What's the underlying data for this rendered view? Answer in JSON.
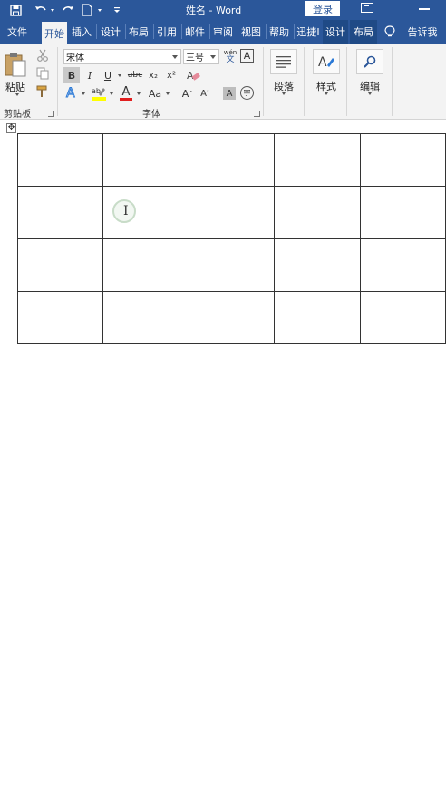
{
  "window": {
    "title": "姓名 - Word",
    "login_label": "登录"
  },
  "tabs": [
    {
      "label": "文件"
    },
    {
      "label": "开始"
    },
    {
      "label": "插入"
    },
    {
      "label": "设计"
    },
    {
      "label": "布局"
    },
    {
      "label": "引用"
    },
    {
      "label": "邮件"
    },
    {
      "label": "审阅"
    },
    {
      "label": "视图"
    },
    {
      "label": "帮助"
    },
    {
      "label": "迅捷I"
    },
    {
      "label": "设计"
    },
    {
      "label": "布局"
    }
  ],
  "tell_me": "告诉我",
  "ribbon": {
    "clipboard": {
      "paste_label": "粘贴",
      "group_label": "剪贴板"
    },
    "font": {
      "font_name": "宋体",
      "font_size": "三号",
      "group_label": "字体",
      "bold": "B",
      "italic": "I",
      "underline": "U",
      "strike": "abc",
      "subscript": "x₂",
      "superscript": "x²",
      "font_color_letter": "A",
      "case_label": "Aa",
      "char_shade": "A",
      "enclose": "字",
      "phonetic_top": "wén",
      "phonetic_bottom": "文"
    },
    "paragraph": {
      "label": "段落"
    },
    "styles": {
      "label": "样式"
    },
    "editing": {
      "label": "编辑"
    }
  },
  "table": {
    "rows": [
      [
        "",
        "",
        "",
        "",
        ""
      ],
      [
        "",
        "",
        "",
        "",
        ""
      ],
      [
        "",
        "",
        "",
        "",
        ""
      ],
      [
        "",
        "",
        "",
        "",
        ""
      ]
    ]
  },
  "colors": {
    "brand": "#2b579a",
    "highlight": "#ffff00",
    "font_color": "#e11f1f"
  }
}
